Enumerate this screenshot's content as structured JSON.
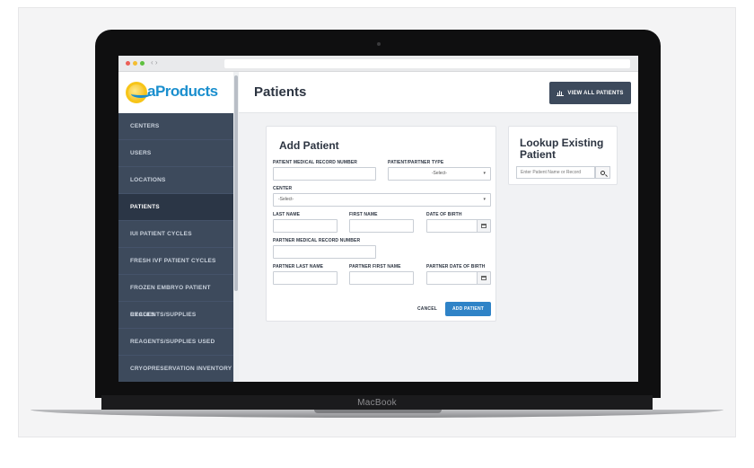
{
  "laptop": {
    "brand_label": "MacBook"
  },
  "browser": {
    "nav_arrows": "‹ ›"
  },
  "app": {
    "logo_text": "aProducts",
    "page_title": "Patients",
    "view_all_label": "VIEW ALL PATIENTS"
  },
  "sidebar": {
    "items": [
      {
        "label": "CENTERS",
        "active": false
      },
      {
        "label": "USERS",
        "active": false
      },
      {
        "label": "LOCATIONS",
        "active": false
      },
      {
        "label": "PATIENTS",
        "active": true
      },
      {
        "label": "IUI PATIENT CYCLES",
        "active": false
      },
      {
        "label": "FRESH IVF PATIENT CYCLES",
        "active": false
      },
      {
        "label": "FROZEN EMBRYO PATIENT CYCLES",
        "active": false
      },
      {
        "label": "REAGENTS/SUPPLIES",
        "active": false
      },
      {
        "label": "REAGENTS/SUPPLIES USED",
        "active": false
      },
      {
        "label": "CRYOPRESERVATION INVENTORY",
        "active": false
      }
    ]
  },
  "add_patient": {
    "title": "Add Patient",
    "mrn_label": "PATIENT MEDICAL RECORD NUMBER",
    "mrn_value": "",
    "type_label": "PATIENT/PARTNER TYPE",
    "type_value": "-Select-",
    "center_label": "CENTER",
    "center_value": "-Select-",
    "last_name_label": "LAST NAME",
    "first_name_label": "FIRST NAME",
    "dob_label": "DATE OF BIRTH",
    "partner_mrn_label": "PARTNER MEDICAL RECORD NUMBER",
    "partner_last_label": "PARTNER LAST NAME",
    "partner_first_label": "PARTNER FIRST NAME",
    "partner_dob_label": "PARTNER DATE OF BIRTH",
    "cancel_label": "CANCEL",
    "submit_label": "ADD PATIENT"
  },
  "lookup": {
    "title": "Lookup Existing Patient",
    "search_placeholder": "Enter Patient Name or Record"
  },
  "colors": {
    "sidebar_bg": "#3d4a5c",
    "sidebar_active": "#2b3646",
    "primary_button": "#2f83c7",
    "logo_blue": "#1b8fce",
    "logo_yellow": "#f2b705"
  }
}
